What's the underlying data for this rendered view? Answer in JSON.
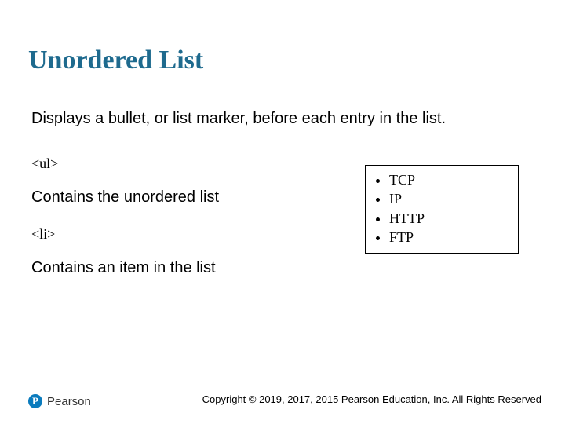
{
  "title": "Unordered List",
  "description": "Displays a bullet, or list marker, before each entry in the list.",
  "tags": {
    "ul": "<ul>",
    "ul_explain": "Contains the unordered list",
    "li": "<li>",
    "li_explain": "Contains an item in the list"
  },
  "example_items": [
    "TCP",
    "IP",
    "HTTP",
    "FTP"
  ],
  "footer": {
    "copyright": "Copyright © 2019, 2017, 2015 Pearson Education, Inc. All Rights Reserved",
    "publisher": "Pearson",
    "logo_letter": "P"
  }
}
